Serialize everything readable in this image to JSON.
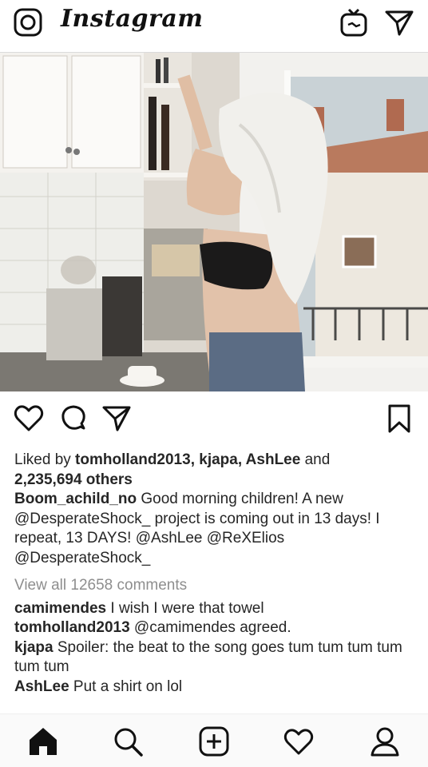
{
  "header": {
    "brand": "Instagram",
    "camera_icon": "camera-icon",
    "igtv_icon": "igtv-icon",
    "direct_icon": "paper-plane-icon"
  },
  "post": {
    "image_alt": "Woman drying hair with a towel in a kitchen by a window",
    "actions": [
      "heart-icon",
      "comment-icon",
      "share-icon",
      "bookmark-icon"
    ],
    "likes": {
      "prefix": "Liked by ",
      "names": "tomholland2013, kjapa, AshLee",
      "conj": " and",
      "others": "2,235,694 others"
    },
    "caption": {
      "user": "Boom_achild_no",
      "text": " Good morning children! A new @DesperateShock_ project is coming out in 13 days! I repeat, 13 DAYS! @AshLee @ReXElios @DesperateShock_"
    },
    "view_all": "View all 12658 comments",
    "comments": [
      {
        "user": "camimendes",
        "text": " I wish I were that towel"
      },
      {
        "user": "tomholland2013",
        "text": " @camimendes agreed."
      },
      {
        "user": "kjapa",
        "text": " Spoiler: the beat to the song goes tum tum tum tum tum tum"
      },
      {
        "user": "AshLee",
        "text": " Put a shirt on lol"
      }
    ]
  },
  "tabbar": [
    "home-icon",
    "search-icon",
    "new-post-icon",
    "activity-icon",
    "profile-icon"
  ],
  "colors": {
    "text": "#262626",
    "muted": "#8e8e8e",
    "bar": "#fafafa",
    "border": "#dbdbdb"
  }
}
